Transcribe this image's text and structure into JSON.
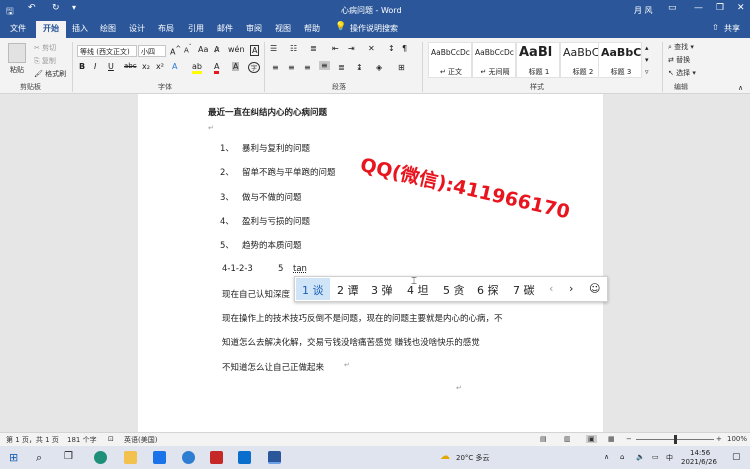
{
  "titlebar": {
    "doc_title": "心病问题 - Word",
    "user": "月 风",
    "controls": [
      "—",
      "❐",
      "✕"
    ]
  },
  "tabs": [
    "文件",
    "开始",
    "插入",
    "绘图",
    "设计",
    "布局",
    "引用",
    "邮件",
    "审阅",
    "视图",
    "帮助",
    "操作说明搜索"
  ],
  "active_tab": "开始",
  "share_label": "共享",
  "ribbon": {
    "clipboard": {
      "paste": "粘贴",
      "cut": "剪切",
      "copy": "复制",
      "format_painter": "格式刷",
      "label": "剪贴板"
    },
    "font": {
      "font_name": "等线 (西文正文)",
      "font_size": "小四",
      "label": "字体",
      "buttons": [
        "B",
        "I",
        "U",
        "abc",
        "x₂",
        "x²",
        "A",
        "A",
        "A",
        "A",
        "A",
        "Aa",
        "A",
        "A",
        "wén"
      ]
    },
    "paragraph": {
      "label": "段落"
    },
    "styles": {
      "label": "样式",
      "items": [
        {
          "sample": "AaBbCcDc",
          "name": "↵ 正文"
        },
        {
          "sample": "AaBbCcDc",
          "name": "↵ 无间隔"
        },
        {
          "sample": "AaBl",
          "name": "标题 1"
        },
        {
          "sample": "AaBbC",
          "name": "标题 2"
        },
        {
          "sample": "AaBbC",
          "name": "标题 3"
        }
      ]
    },
    "editing": {
      "find": "查找",
      "replace": "替换",
      "select": "选择",
      "label": "编辑"
    }
  },
  "document": {
    "title": "最近一直在纠结内心的心病问题",
    "list": [
      {
        "num": "1、",
        "text": "暴利与复利的问题"
      },
      {
        "num": "2、",
        "text": "留单不跑与平单跑的问题"
      },
      {
        "num": "3、",
        "text": "做与不做的问题"
      },
      {
        "num": "4、",
        "text": "盈利与亏损的问题"
      },
      {
        "num": "5、",
        "text": "趋势的本质问题"
      }
    ],
    "sequence": "4-1-2-3",
    "five": "5",
    "typing": "tan",
    "para1": "现在自己认知深度",
    "para2": "现在操作上的技术技巧反倒不是问题，现在的问题主要就是内心的心病，不",
    "para3": "知道怎么去解决化解，交易亏钱没啥痛苦感觉 赚钱也没啥快乐的感觉",
    "para4": "不知道怎么让自己正做起来",
    "para_mark": "↵"
  },
  "watermark": "QQ(微信):411966170",
  "ime": {
    "candidates": [
      "1 谈",
      "2 谭",
      "3 弹",
      "4 坦",
      "5 贪",
      "6 探",
      "7 碳"
    ],
    "prev": "‹",
    "next": "›",
    "emoji": "☺"
  },
  "statusbar": {
    "page": "第 1 页，共 1 页",
    "words": "181 个字",
    "language": "英语(美国)",
    "zoom": "100%"
  },
  "taskbar": {
    "weather": "20°C 多云",
    "ime_lang": "中",
    "time": "14:56",
    "date": "2021/6/26"
  }
}
